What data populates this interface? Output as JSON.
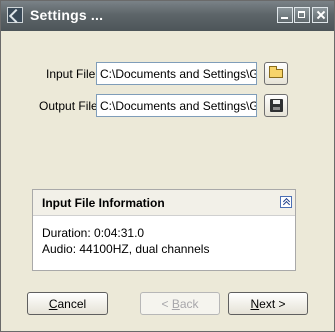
{
  "window": {
    "title": "Settings ..."
  },
  "form": {
    "input_label": "Input File:",
    "input_value": "C:\\Documents and Settings\\Gre",
    "output_label": "Output File:",
    "output_value": "C:\\Documents and Settings\\Gre"
  },
  "icons": {
    "app": "app-icon",
    "browse": "folder-open-icon",
    "save": "floppy-save-icon",
    "collapse": "double-chevron-up-icon"
  },
  "info_panel": {
    "title": "Input File Information",
    "duration": "Duration: 0:04:31.0",
    "audio": "Audio: 44100HZ, dual channels"
  },
  "buttons": {
    "cancel_underlined": "C",
    "cancel_rest": "ancel",
    "back_prefix": "< ",
    "back_underlined": "B",
    "back_rest": "ack",
    "next_underlined": "N",
    "next_rest": "ext >"
  },
  "colors": {
    "titlebar": "#5d6569",
    "dialog_background": "#ece9d8",
    "field_border": "#7f9db9",
    "disabled_text": "#a7a6aa"
  }
}
